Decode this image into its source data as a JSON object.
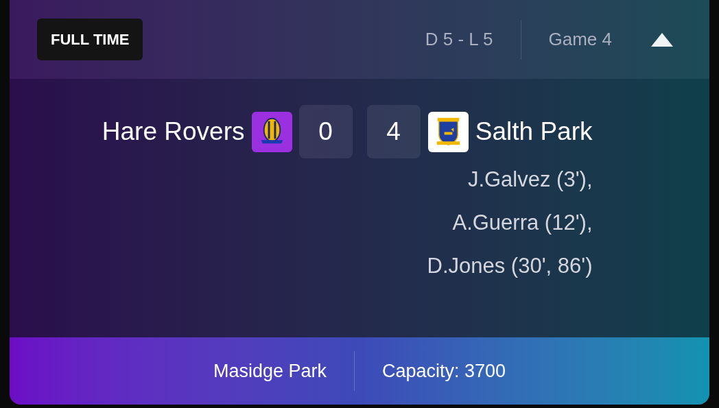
{
  "status": "FULL TIME",
  "record": "D 5 - L 5",
  "game": "Game 4",
  "expanded": true,
  "home": {
    "name": "Hare Rovers",
    "score": "0"
  },
  "away": {
    "name": "Salth Park",
    "score": "4"
  },
  "scorers": [
    "J.Galvez (3'),",
    "A.Guerra (12'),",
    "D.Jones (30', 86')"
  ],
  "venue": "Masidge Park",
  "capacity": "Capacity: 3700"
}
